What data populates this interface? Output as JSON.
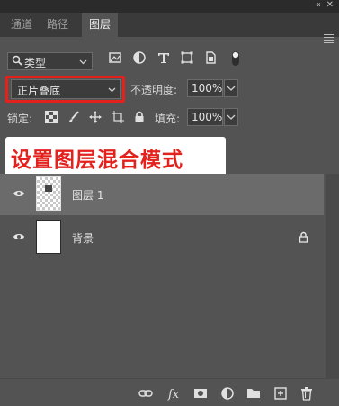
{
  "tabs": [
    {
      "label": "通道",
      "active": false
    },
    {
      "label": "路径",
      "active": false
    },
    {
      "label": "图层",
      "active": true
    }
  ],
  "filter": {
    "kind_label": "类型",
    "icons": [
      "pixel-filter-icon",
      "adjustment-filter-icon",
      "type-filter-icon",
      "shape-filter-icon",
      "smart-object-filter-icon",
      "filter-toggle-icon"
    ]
  },
  "blend": {
    "mode": "正片叠底",
    "opacity_label": "不透明度:",
    "opacity_value": "100%"
  },
  "lock": {
    "label": "锁定:",
    "fill_label": "填充:",
    "fill_value": "100%"
  },
  "annotation": {
    "text": "设置图层混合模式",
    "color": "#e3221d"
  },
  "layers": [
    {
      "name": "图层 1",
      "selected": true,
      "visible": true,
      "locked": false
    },
    {
      "name": "背景",
      "selected": false,
      "visible": true,
      "locked": true
    }
  ],
  "bottom_icons": [
    "link-icon",
    "fx-icon",
    "mask-icon",
    "adjustment-layer-icon",
    "group-folder-icon",
    "new-layer-icon",
    "trash-icon"
  ],
  "colors": {
    "panel": "#535353",
    "accent_red": "#e3221d",
    "selected_row": "#6b6b6b"
  }
}
